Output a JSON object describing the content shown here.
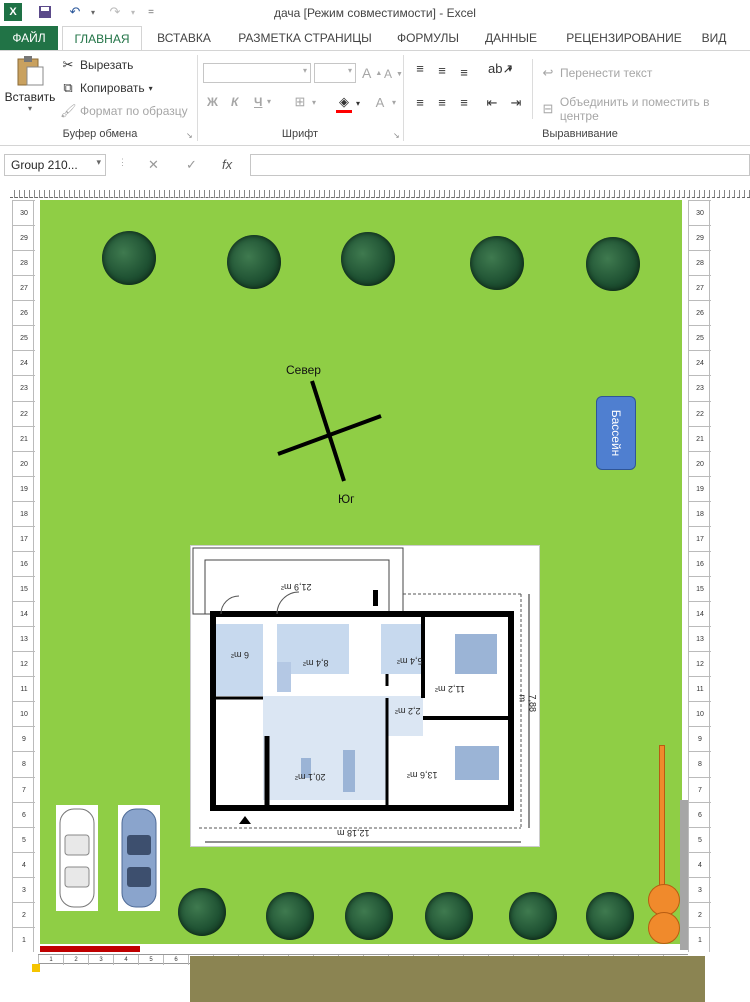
{
  "window": {
    "title": "дача  [Режим совместимости] - Excel"
  },
  "tabs": [
    "ФАЙЛ",
    "ГЛАВНАЯ",
    "ВСТАВКА",
    "РАЗМЕТКА СТРАНИЦЫ",
    "ФОРМУЛЫ",
    "ДАННЫЕ",
    "РЕЦЕНЗИРОВАНИЕ",
    "ВИД"
  ],
  "ribbon": {
    "paste": "Вставить",
    "cut": "Вырезать",
    "copy": "Копировать",
    "format_painter": "Формат по образцу",
    "clipboard_group": "Буфер обмена",
    "font_group": "Шрифт",
    "bold": "Ж",
    "italic": "К",
    "underline": "Ч",
    "wrap_text": "Перенести текст",
    "merge_center": "Объединить и поместить в центре",
    "alignment_group": "Выравнивание"
  },
  "formula_bar": {
    "name_box": "Group 210...",
    "fx": "fx"
  },
  "compass": {
    "north": "Север",
    "south": "Юг"
  },
  "pool": {
    "label": "Бассейн"
  },
  "plan": {
    "area_terrace": "21,9 m²",
    "area_bath": "6 m²",
    "area_kitchen": "8,4 m²",
    "area_wc": "5,4 m²",
    "area_bed1": "11,2 m²",
    "area_hall": "2,2 m²",
    "area_living": "20,1 m²",
    "area_bed2": "13,6 m²",
    "width": "12,18 m",
    "depth": "7,88 m"
  },
  "rulers": {
    "left": [
      "30",
      "29",
      "28",
      "27",
      "26",
      "25",
      "24",
      "23",
      "22",
      "21",
      "20",
      "19",
      "18",
      "17",
      "16",
      "15",
      "14",
      "13",
      "12",
      "11",
      "10",
      "9",
      "8",
      "7",
      "6",
      "5",
      "4",
      "3",
      "2",
      "1"
    ],
    "bottom": [
      "1",
      "2",
      "3",
      "4",
      "5",
      "6",
      "7",
      "8",
      "9",
      "10",
      "11",
      "12",
      "13",
      "14",
      "15",
      "16",
      "17",
      "18",
      "19",
      "20",
      "21",
      "22",
      "23",
      "24",
      "25",
      "26"
    ]
  },
  "colors": {
    "lawn": "#8fce45",
    "excel_green": "#217346",
    "pool": "#4f7fd0",
    "lamp": "#f08a2c"
  }
}
